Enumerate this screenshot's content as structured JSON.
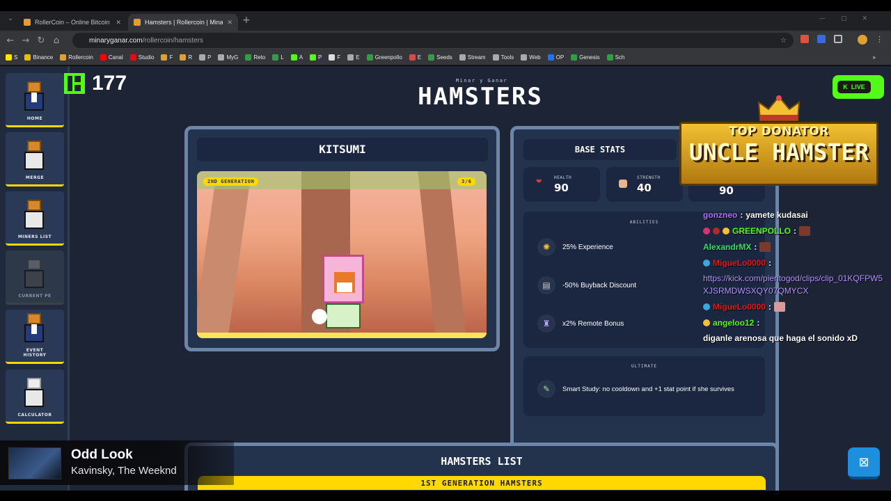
{
  "browser": {
    "tabs": [
      {
        "label": "RollerCoin – Online Bitcoin Mining"
      },
      {
        "label": "Hamsters | Rollercoin | Minar y Ganar"
      }
    ],
    "new_tab": "+",
    "url_domain": "minaryganar.com",
    "url_path": "/rollercoin/hamsters",
    "bookmarks": [
      "S",
      "Binance",
      "Rollercoin",
      "Canal",
      "Studio",
      "F",
      "R",
      "P",
      "MyG",
      "Reto",
      "L",
      "A",
      "P",
      "F",
      "E",
      "Greenpollo",
      "E",
      "Seeds",
      "Stream",
      "Tools",
      "Web",
      "OP",
      "Genesis",
      "Sch"
    ],
    "bookmark_more": "»"
  },
  "sidebar": {
    "items": [
      {
        "label": "HOME"
      },
      {
        "label": "MERGE"
      },
      {
        "label": "MINERS LIST"
      },
      {
        "label": "CURRENT PE"
      },
      {
        "label": "EVENT HISTORY"
      },
      {
        "label": "CALCULATOR"
      }
    ]
  },
  "header": {
    "subtitle": "Minar y Ganar",
    "title": "HAMSTERS"
  },
  "hamster": {
    "name": "KITSUMI",
    "generation_badge": "2ND GENERATION",
    "counter": "3/6"
  },
  "stats": {
    "title": "BASE STATS",
    "health_label": "HEALTH",
    "health_value": "90",
    "strength_label": "STRENGTH",
    "strength_value": "40",
    "third_value": "90"
  },
  "abilities": {
    "title": "ABILITIES",
    "items": [
      {
        "text": "25% Experience"
      },
      {
        "text": "-50% Buyback Discount"
      },
      {
        "text": "x2% Remote Bonus"
      }
    ]
  },
  "ultimate": {
    "title": "ULTIMATE",
    "text": "Smart Study: no cooldown and +1 stat point if she survives"
  },
  "list": {
    "title": "HAMSTERS LIST",
    "gen1": "1ST GENERATION HAMSTERS"
  },
  "overlay": {
    "viewer_count": "177",
    "live_label": "LIVE",
    "donator_top": "TOP DONATOR",
    "donator_name": "UNCLE HAMSTER",
    "chat": [
      {
        "user": "gonzneo",
        "sep": ":",
        "msg": "yamete kudasai"
      },
      {
        "user": "GREENPOLLO",
        "sep": ":",
        "msg": ""
      },
      {
        "user": "AlexandrMX",
        "sep": ":",
        "msg": ""
      },
      {
        "user": "MigueLo0000",
        "sep": ":",
        "msg": "https://kick.com/pieritogod/clips/clip_01KQFPW5XJSRMDWSXQY07QMYCX"
      },
      {
        "user": "MigueLo0000",
        "sep": ":",
        "msg": ""
      },
      {
        "user": "angeloo12",
        "sep": ":",
        "msg": "diganle arenosa que haga el sonido xD"
      }
    ],
    "music_title": "Odd Look",
    "music_artist": "Kavinsky, The Weeknd"
  },
  "colors": {
    "accent_yellow": "#ffd800",
    "kick_green": "#53fc18",
    "panel_bg": "#24334d",
    "panel_border": "#6d85a8"
  }
}
